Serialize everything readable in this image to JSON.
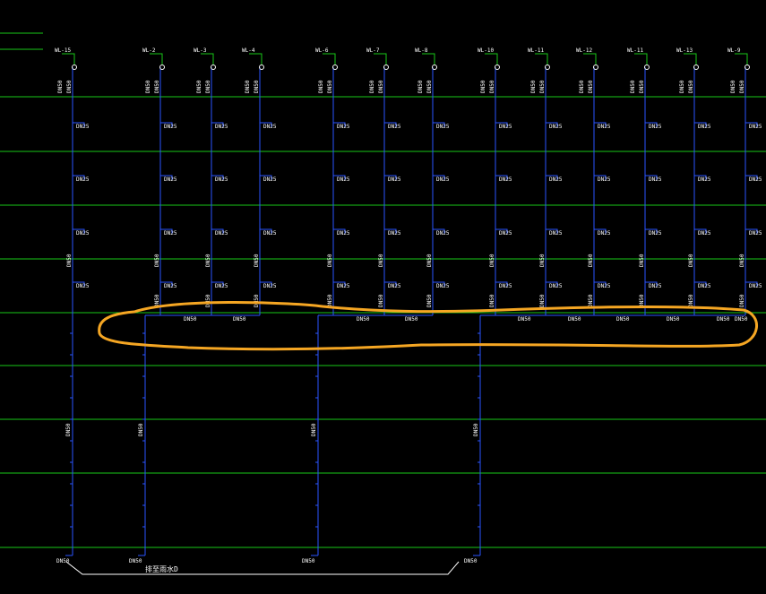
{
  "colors": {
    "background": "#000000",
    "floor_line": "#19c819",
    "pipe": "#2a55ff",
    "connector": "#19c819",
    "text": "#ffffff",
    "markup": "#f5a623"
  },
  "risers": [
    {
      "label": "WL-15",
      "pipe_label": "DN50"
    },
    {
      "label": "WL-2",
      "pipe_label": "DN50"
    },
    {
      "label": "WL-3",
      "pipe_label": "DN50"
    },
    {
      "label": "WL-4",
      "pipe_label": "DN50"
    },
    {
      "label": "WL-6",
      "pipe_label": "DN50"
    },
    {
      "label": "WL-7",
      "pipe_label": "DN50"
    },
    {
      "label": "WL-8",
      "pipe_label": "DN50"
    },
    {
      "label": "WL-10",
      "pipe_label": "DN50"
    },
    {
      "label": "WL-11",
      "pipe_label": "DN50"
    },
    {
      "label": "WL-12",
      "pipe_label": "DN50"
    },
    {
      "label": "WL-11",
      "pipe_label": "DN50"
    },
    {
      "label": "WL-13",
      "pipe_label": "DN50"
    },
    {
      "label": "WL-9",
      "pipe_label": "DN50"
    }
  ],
  "branch_label": "DN25",
  "collector_labels": [
    "DN50",
    "DN50",
    "DN50",
    "DN50",
    "DN50",
    "DN50",
    "DN50",
    "DN50",
    "DN50",
    "DN50"
  ],
  "main_risers": [
    {
      "label": "DN50",
      "bottom_label": "DN50"
    },
    {
      "label": "DN50",
      "bottom_label": "DN50"
    },
    {
      "label": "DN50",
      "bottom_label": "DN50"
    },
    {
      "label": "DN50",
      "bottom_label": "DN50"
    }
  ],
  "discharge_note": "排至雨水D"
}
